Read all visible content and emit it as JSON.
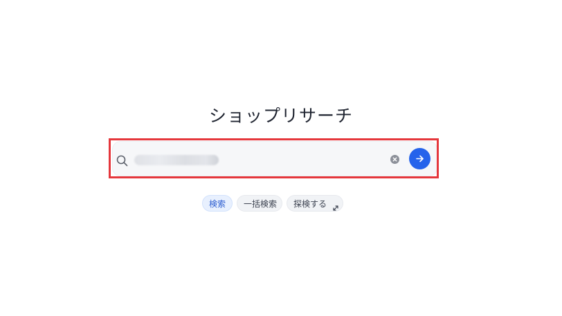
{
  "page": {
    "title": "ショップリサーチ"
  },
  "search": {
    "value": "",
    "placeholder": ""
  },
  "icons": {
    "search": "search-icon",
    "clear": "clear-icon",
    "submit": "arrow-right-icon",
    "expand": "expand-icon"
  },
  "chips": {
    "search_label": "検索",
    "bulk_label": "一括検索",
    "explore_label": "探検する"
  },
  "colors": {
    "accent": "#2563eb",
    "highlight_border": "#e5373c",
    "active_chip_bg": "#e8f0fe"
  }
}
